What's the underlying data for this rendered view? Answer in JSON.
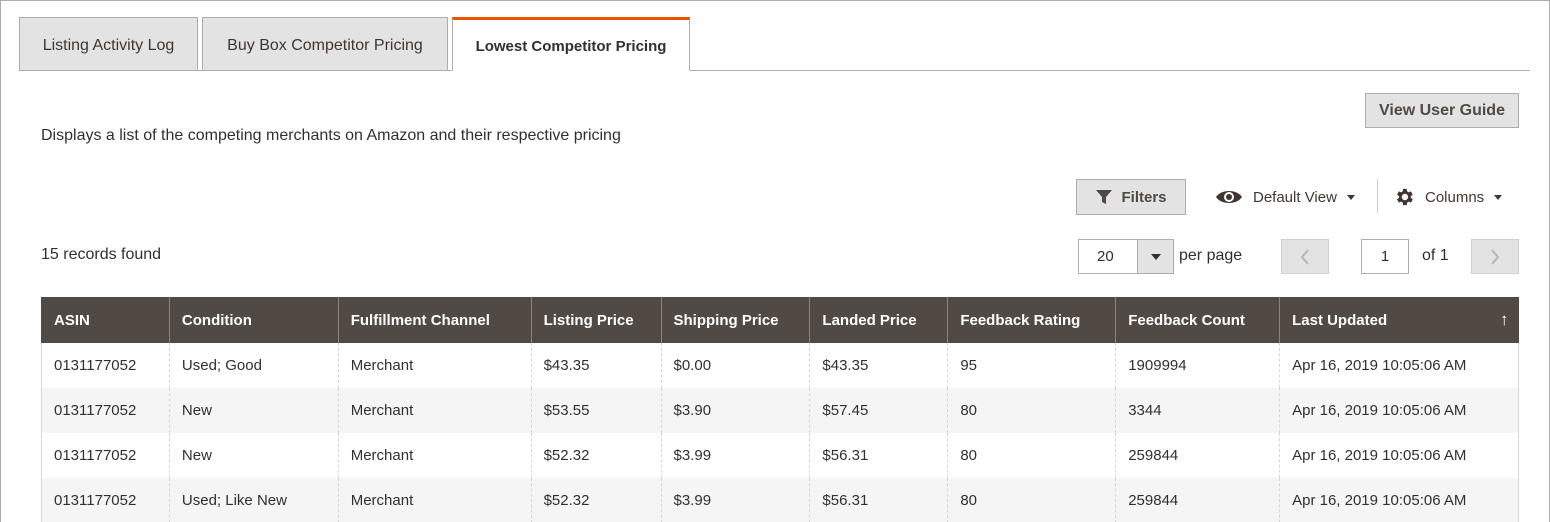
{
  "tabs": [
    {
      "label": "Listing Activity Log"
    },
    {
      "label": "Buy Box Competitor Pricing"
    },
    {
      "label": "Lowest Competitor Pricing"
    }
  ],
  "description": "Displays a list of the competing merchants on Amazon and their respective pricing",
  "toolbar": {
    "guide_label": "View User Guide",
    "filters_label": "Filters",
    "view_label": "Default View",
    "columns_label": "Columns"
  },
  "grid_meta": {
    "records_found": "15 records found",
    "per_page_value": "20",
    "per_page_label": "per page",
    "current_page": "1",
    "page_total": "of 1"
  },
  "colors": {
    "accent": "#eb5202",
    "header_bg": "#514943"
  },
  "table": {
    "columns": [
      "ASIN",
      "Condition",
      "Fulfillment Channel",
      "Listing Price",
      "Shipping Price",
      "Landed Price",
      "Feedback Rating",
      "Feedback Count",
      "Last Updated"
    ],
    "sort_indicator": "↑",
    "rows": [
      [
        "0131177052",
        "Used; Good",
        "Merchant",
        "$43.35",
        "$0.00",
        "$43.35",
        "95",
        "1909994",
        "Apr 16, 2019 10:05:06 AM"
      ],
      [
        "0131177052",
        "New",
        "Merchant",
        "$53.55",
        "$3.90",
        "$57.45",
        "80",
        "3344",
        "Apr 16, 2019 10:05:06 AM"
      ],
      [
        "0131177052",
        "New",
        "Merchant",
        "$52.32",
        "$3.99",
        "$56.31",
        "80",
        "259844",
        "Apr 16, 2019 10:05:06 AM"
      ],
      [
        "0131177052",
        "Used; Like New",
        "Merchant",
        "$52.32",
        "$3.99",
        "$56.31",
        "80",
        "259844",
        "Apr 16, 2019 10:05:06 AM"
      ]
    ]
  }
}
